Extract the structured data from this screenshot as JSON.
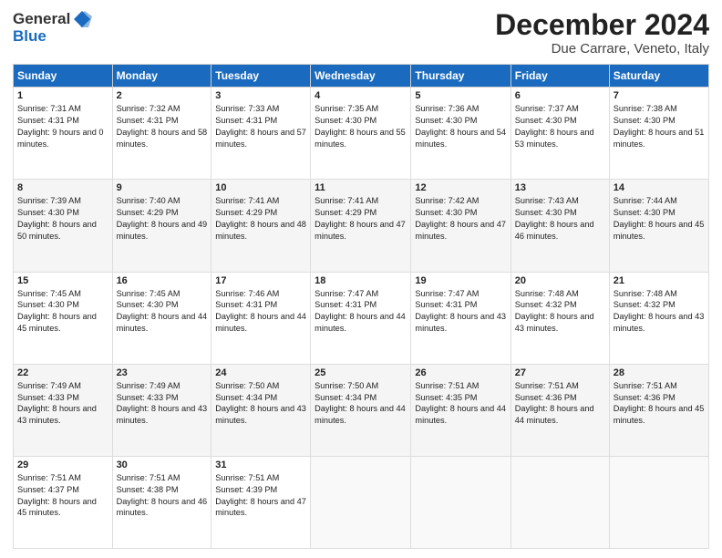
{
  "header": {
    "logo": {
      "line1": "General",
      "line2": "Blue"
    },
    "title": "December 2024",
    "location": "Due Carrare, Veneto, Italy"
  },
  "days_of_week": [
    "Sunday",
    "Monday",
    "Tuesday",
    "Wednesday",
    "Thursday",
    "Friday",
    "Saturday"
  ],
  "weeks": [
    [
      {
        "day": "1",
        "sunrise": "Sunrise: 7:31 AM",
        "sunset": "Sunset: 4:31 PM",
        "daylight": "Daylight: 9 hours and 0 minutes."
      },
      {
        "day": "2",
        "sunrise": "Sunrise: 7:32 AM",
        "sunset": "Sunset: 4:31 PM",
        "daylight": "Daylight: 8 hours and 58 minutes."
      },
      {
        "day": "3",
        "sunrise": "Sunrise: 7:33 AM",
        "sunset": "Sunset: 4:31 PM",
        "daylight": "Daylight: 8 hours and 57 minutes."
      },
      {
        "day": "4",
        "sunrise": "Sunrise: 7:35 AM",
        "sunset": "Sunset: 4:30 PM",
        "daylight": "Daylight: 8 hours and 55 minutes."
      },
      {
        "day": "5",
        "sunrise": "Sunrise: 7:36 AM",
        "sunset": "Sunset: 4:30 PM",
        "daylight": "Daylight: 8 hours and 54 minutes."
      },
      {
        "day": "6",
        "sunrise": "Sunrise: 7:37 AM",
        "sunset": "Sunset: 4:30 PM",
        "daylight": "Daylight: 8 hours and 53 minutes."
      },
      {
        "day": "7",
        "sunrise": "Sunrise: 7:38 AM",
        "sunset": "Sunset: 4:30 PM",
        "daylight": "Daylight: 8 hours and 51 minutes."
      }
    ],
    [
      {
        "day": "8",
        "sunrise": "Sunrise: 7:39 AM",
        "sunset": "Sunset: 4:30 PM",
        "daylight": "Daylight: 8 hours and 50 minutes."
      },
      {
        "day": "9",
        "sunrise": "Sunrise: 7:40 AM",
        "sunset": "Sunset: 4:29 PM",
        "daylight": "Daylight: 8 hours and 49 minutes."
      },
      {
        "day": "10",
        "sunrise": "Sunrise: 7:41 AM",
        "sunset": "Sunset: 4:29 PM",
        "daylight": "Daylight: 8 hours and 48 minutes."
      },
      {
        "day": "11",
        "sunrise": "Sunrise: 7:41 AM",
        "sunset": "Sunset: 4:29 PM",
        "daylight": "Daylight: 8 hours and 47 minutes."
      },
      {
        "day": "12",
        "sunrise": "Sunrise: 7:42 AM",
        "sunset": "Sunset: 4:30 PM",
        "daylight": "Daylight: 8 hours and 47 minutes."
      },
      {
        "day": "13",
        "sunrise": "Sunrise: 7:43 AM",
        "sunset": "Sunset: 4:30 PM",
        "daylight": "Daylight: 8 hours and 46 minutes."
      },
      {
        "day": "14",
        "sunrise": "Sunrise: 7:44 AM",
        "sunset": "Sunset: 4:30 PM",
        "daylight": "Daylight: 8 hours and 45 minutes."
      }
    ],
    [
      {
        "day": "15",
        "sunrise": "Sunrise: 7:45 AM",
        "sunset": "Sunset: 4:30 PM",
        "daylight": "Daylight: 8 hours and 45 minutes."
      },
      {
        "day": "16",
        "sunrise": "Sunrise: 7:45 AM",
        "sunset": "Sunset: 4:30 PM",
        "daylight": "Daylight: 8 hours and 44 minutes."
      },
      {
        "day": "17",
        "sunrise": "Sunrise: 7:46 AM",
        "sunset": "Sunset: 4:31 PM",
        "daylight": "Daylight: 8 hours and 44 minutes."
      },
      {
        "day": "18",
        "sunrise": "Sunrise: 7:47 AM",
        "sunset": "Sunset: 4:31 PM",
        "daylight": "Daylight: 8 hours and 44 minutes."
      },
      {
        "day": "19",
        "sunrise": "Sunrise: 7:47 AM",
        "sunset": "Sunset: 4:31 PM",
        "daylight": "Daylight: 8 hours and 43 minutes."
      },
      {
        "day": "20",
        "sunrise": "Sunrise: 7:48 AM",
        "sunset": "Sunset: 4:32 PM",
        "daylight": "Daylight: 8 hours and 43 minutes."
      },
      {
        "day": "21",
        "sunrise": "Sunrise: 7:48 AM",
        "sunset": "Sunset: 4:32 PM",
        "daylight": "Daylight: 8 hours and 43 minutes."
      }
    ],
    [
      {
        "day": "22",
        "sunrise": "Sunrise: 7:49 AM",
        "sunset": "Sunset: 4:33 PM",
        "daylight": "Daylight: 8 hours and 43 minutes."
      },
      {
        "day": "23",
        "sunrise": "Sunrise: 7:49 AM",
        "sunset": "Sunset: 4:33 PM",
        "daylight": "Daylight: 8 hours and 43 minutes."
      },
      {
        "day": "24",
        "sunrise": "Sunrise: 7:50 AM",
        "sunset": "Sunset: 4:34 PM",
        "daylight": "Daylight: 8 hours and 43 minutes."
      },
      {
        "day": "25",
        "sunrise": "Sunrise: 7:50 AM",
        "sunset": "Sunset: 4:34 PM",
        "daylight": "Daylight: 8 hours and 44 minutes."
      },
      {
        "day": "26",
        "sunrise": "Sunrise: 7:51 AM",
        "sunset": "Sunset: 4:35 PM",
        "daylight": "Daylight: 8 hours and 44 minutes."
      },
      {
        "day": "27",
        "sunrise": "Sunrise: 7:51 AM",
        "sunset": "Sunset: 4:36 PM",
        "daylight": "Daylight: 8 hours and 44 minutes."
      },
      {
        "day": "28",
        "sunrise": "Sunrise: 7:51 AM",
        "sunset": "Sunset: 4:36 PM",
        "daylight": "Daylight: 8 hours and 45 minutes."
      }
    ],
    [
      {
        "day": "29",
        "sunrise": "Sunrise: 7:51 AM",
        "sunset": "Sunset: 4:37 PM",
        "daylight": "Daylight: 8 hours and 45 minutes."
      },
      {
        "day": "30",
        "sunrise": "Sunrise: 7:51 AM",
        "sunset": "Sunset: 4:38 PM",
        "daylight": "Daylight: 8 hours and 46 minutes."
      },
      {
        "day": "31",
        "sunrise": "Sunrise: 7:51 AM",
        "sunset": "Sunset: 4:39 PM",
        "daylight": "Daylight: 8 hours and 47 minutes."
      },
      null,
      null,
      null,
      null
    ]
  ]
}
